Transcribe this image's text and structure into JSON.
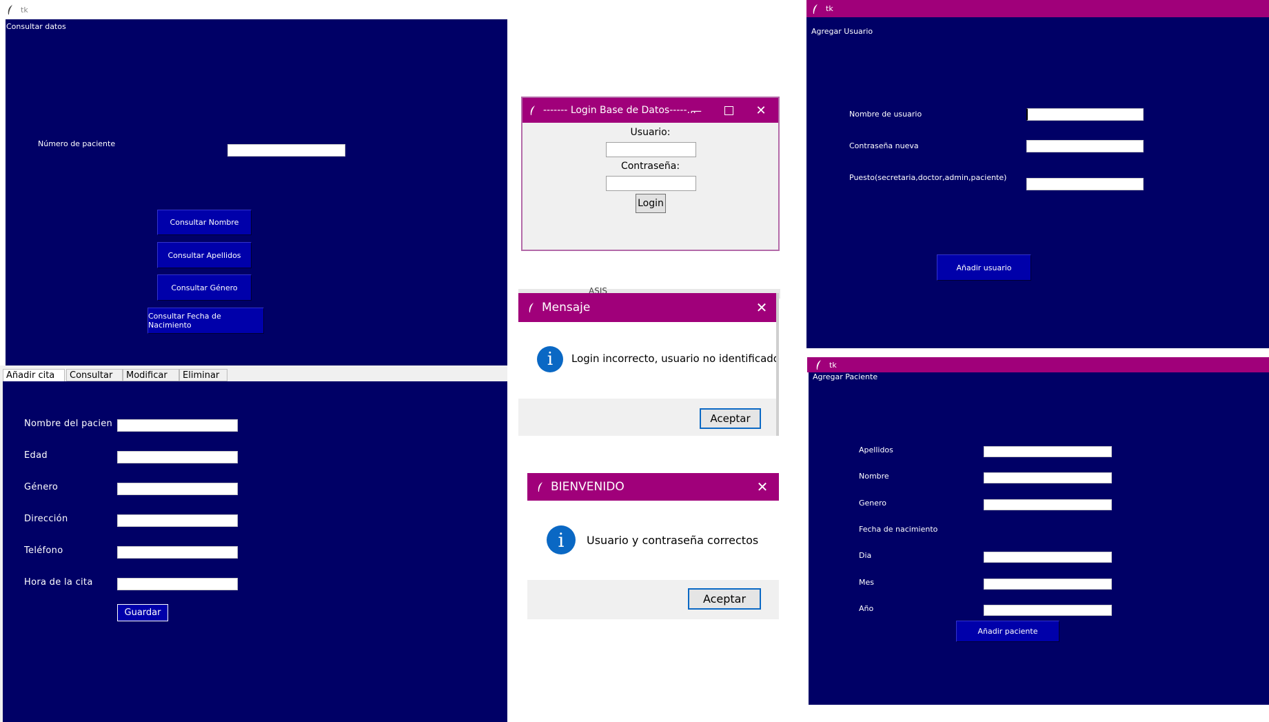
{
  "consultar": {
    "title": "tk",
    "heading": "Consultar datos",
    "label_numero": "Número de paciente",
    "buttons": [
      "Consultar Nombre",
      "Consultar Apellidos",
      "Consultar Género",
      "Consultar Fecha de Nacimiento"
    ]
  },
  "citas": {
    "tabs": [
      "Añadir cita",
      "Consultar",
      "Modificar",
      "Eliminar"
    ],
    "labels": [
      "Nombre del pacien",
      "Edad",
      "Género",
      "Dirección",
      "Teléfono",
      "Hora de la cita"
    ],
    "save_label": "Guardar"
  },
  "login": {
    "title": "------- Login Base de Datos-----...",
    "usuario_label": "Usuario:",
    "password_label": "Contraseña:",
    "login_button": "Login"
  },
  "mensaje": {
    "title": "Mensaje",
    "text": "Login incorrecto, usuario no identificado",
    "ok": "Aceptar",
    "behind_text": "ASIS"
  },
  "bienvenido": {
    "title": "BIENVENIDO",
    "text": "Usuario y contraseña correctos",
    "ok": "Aceptar"
  },
  "agregar_usuario": {
    "title": "tk",
    "heading": "Agregar Usuario",
    "labels": [
      "Nombre de usuario",
      "Contraseña nueva",
      "Puesto(secretaria,doctor,admin,paciente)"
    ],
    "button": "Añadir usuario"
  },
  "agregar_paciente": {
    "title": "tk",
    "heading": "Agregar Paciente",
    "labels": [
      "Apellidos",
      "Nombre",
      "Genero",
      "Fecha de nacimiento",
      "Dia",
      "Mes",
      "Año"
    ],
    "button": "Añadir paciente"
  },
  "colors": {
    "navy": "#000066",
    "button_blue": "#0000aa",
    "title_magenta": "#a0007a",
    "info_blue": "#0a68c4"
  }
}
